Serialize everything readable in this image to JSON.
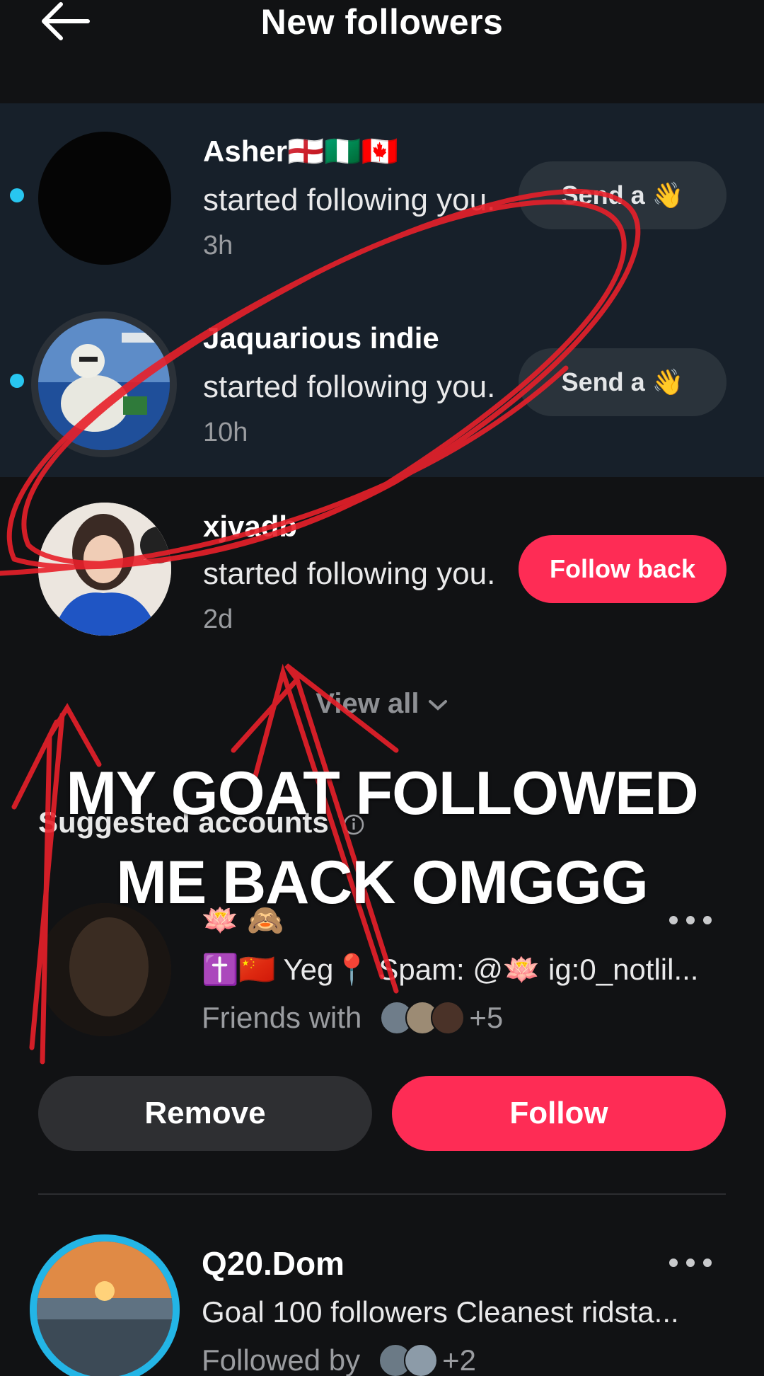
{
  "header": {
    "title": "New followers"
  },
  "followers": [
    {
      "name": "Asher🏴󠁧󠁢󠁥󠁮󠁧󠁿🇳🇬🇨🇦",
      "message": "started following you.",
      "time": "3h",
      "button": "Send a 👋",
      "unread": true
    },
    {
      "name": "Jaquarious indie",
      "message": "started following you.",
      "time": "10h",
      "button": "Send a 👋",
      "unread": true
    },
    {
      "name": "xjvadb",
      "message": "started following you.",
      "time": "2d",
      "button": "Follow back",
      "unread": false
    }
  ],
  "view_all": "View all",
  "suggested": {
    "title": "Suggested accounts",
    "accounts": [
      {
        "name": "🪷 🙈",
        "bio": "✝️🇨🇳 Yeg📍 Spam: @🪷  ig:0_notlil...",
        "friends_label": "Friends with",
        "friends_count": "+5",
        "remove_label": "Remove",
        "follow_label": "Follow"
      },
      {
        "name": "Q20.Dom",
        "bio": "Goal 100 followers Cleanest ridsta...",
        "friends_label": "Followed by",
        "friends_count": "+2"
      }
    ]
  },
  "overlay": {
    "line1": "MY GOAT FOLLOWED",
    "line2": "ME BACK OMGGG"
  },
  "colors": {
    "accent": "#fe2c55",
    "unread_dot": "#28c6f0",
    "annotation": "#e8202a"
  }
}
